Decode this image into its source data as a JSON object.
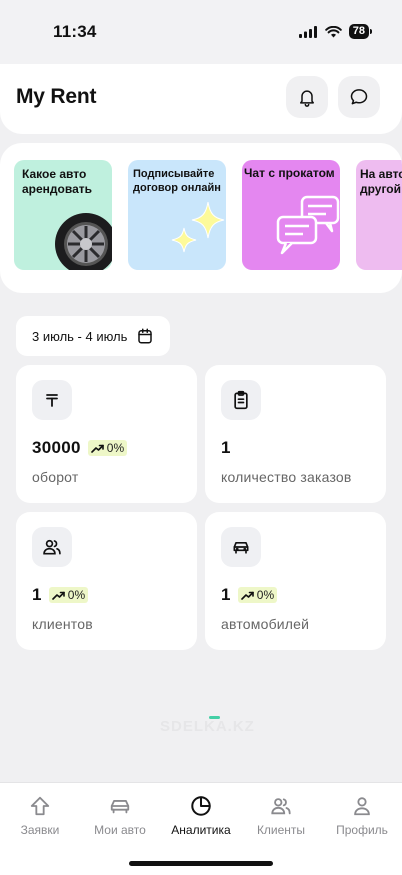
{
  "status_bar": {
    "time": "11:34",
    "battery": "78"
  },
  "header": {
    "title": "My Rent"
  },
  "stories": [
    {
      "text": "Какое авто арендовать"
    },
    {
      "text": "Подписывайте договор онлайн"
    },
    {
      "text": "Чат с прокатом"
    },
    {
      "text": "На авто другой"
    }
  ],
  "date_range": "3 июль - 4 июль",
  "cards": [
    {
      "icon": "tenge-icon",
      "value": "30000",
      "badge": "0%",
      "label": "оборот"
    },
    {
      "icon": "clipboard-icon",
      "value": "1",
      "badge": "",
      "label": "количество заказов"
    },
    {
      "icon": "users-icon",
      "value": "1",
      "badge": "0%",
      "label": "клиентов"
    },
    {
      "icon": "car-icon",
      "value": "1",
      "badge": "0%",
      "label": "автомобилей"
    }
  ],
  "watermark": "SDELKA.KZ",
  "tabs": [
    {
      "label": "Заявки",
      "icon": "home-icon",
      "active": false
    },
    {
      "label": "Мои авто",
      "icon": "car-icon",
      "active": false
    },
    {
      "label": "Аналитика",
      "icon": "pie-chart-icon",
      "active": true
    },
    {
      "label": "Клиенты",
      "icon": "users-icon",
      "active": false
    },
    {
      "label": "Профиль",
      "icon": "profile-icon",
      "active": false
    }
  ],
  "colors": {
    "accent": "#44cfa6",
    "badge_bg": "#eef7c8"
  }
}
